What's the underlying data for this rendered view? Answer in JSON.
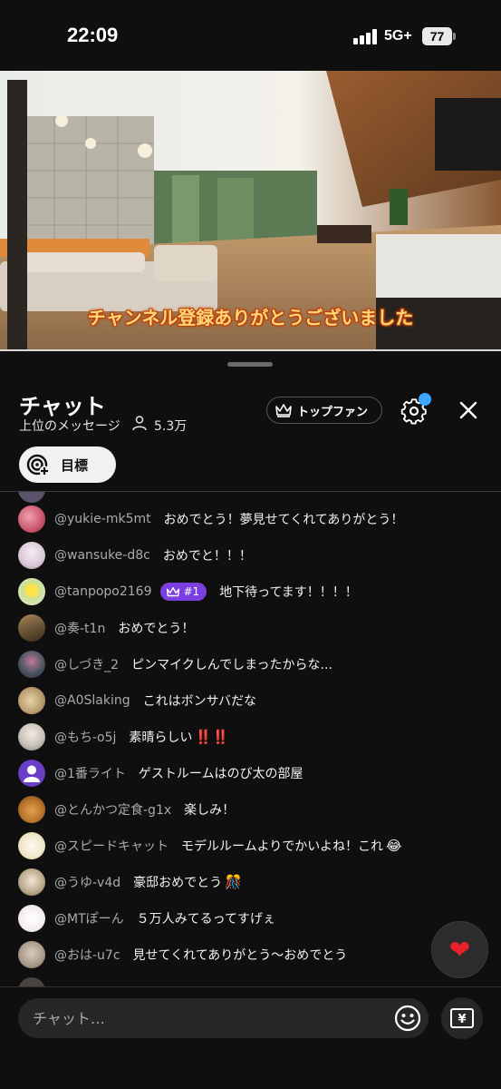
{
  "status_bar": {
    "time": "22:09",
    "network": "5G+",
    "battery": "77"
  },
  "video": {
    "caption": "チャンネル登録ありがとうございました"
  },
  "chat": {
    "title": "チャット",
    "subtitle": "上位のメッセージ",
    "viewer_count": "5.3万",
    "top_fan_label": "トップファン",
    "goal_label": "目標",
    "input_placeholder": "チャット…",
    "heart_icon": "heart",
    "currency_symbol": "¥"
  },
  "messages": [
    {
      "author": "@yukie-mk5mt",
      "text": "おめでとう！夢見せてくれてありがとう！",
      "avatar_color": "#c9566a"
    },
    {
      "author": "@wansuke-d8c",
      "text": "おめでと！！！",
      "avatar_color": "#d9c6d6"
    },
    {
      "author": "@tanpopo2169",
      "badge": "#1",
      "text": "地下待ってます！！！！",
      "avatar_color": "#e8f0d0"
    },
    {
      "author": "@奏-t1n",
      "text": "おめでとう！",
      "avatar_color": "#6b5537"
    },
    {
      "author": "@しづき_2",
      "text": "ピンマイクしんでしまったからな...",
      "avatar_color": "#4b5560"
    },
    {
      "author": "@A0Slaking",
      "text": "これはボンサバだな",
      "avatar_color": "#b79a6c"
    },
    {
      "author": "@もち-o5j",
      "text": "素晴らしい",
      "emoji": "‼️‼️",
      "avatar_color": "#c8c2b8"
    },
    {
      "author": "@1番ライト",
      "text": "ゲストルームはのび太の部屋",
      "avatar_color": "#6a3fc8"
    },
    {
      "author": "@とんかつ定食-g1x",
      "text": "楽しみ！",
      "avatar_color": "#b8732a"
    },
    {
      "author": "@スピードキャット",
      "text": "モデルルームよりでかいよね！これ",
      "emoji": "😂",
      "avatar_color": "#efe6c8"
    },
    {
      "author": "@うゆ-v4d",
      "text": "豪邸おめでとう",
      "emoji": "🎊",
      "avatar_color": "#b8a68a"
    },
    {
      "author": "@MTぽーん",
      "text": "５万人みてるってすげぇ",
      "avatar_color": "#f4eeee"
    },
    {
      "author": "@おは-u7c",
      "text": "見せてくれてありがとう～おめでとう",
      "avatar_color": "#a89888"
    }
  ],
  "colors": {
    "background": "#0f0f0f",
    "badge": "#7b3fe0",
    "notification_dot": "#3ea6ff",
    "heart": "#e8202a"
  }
}
